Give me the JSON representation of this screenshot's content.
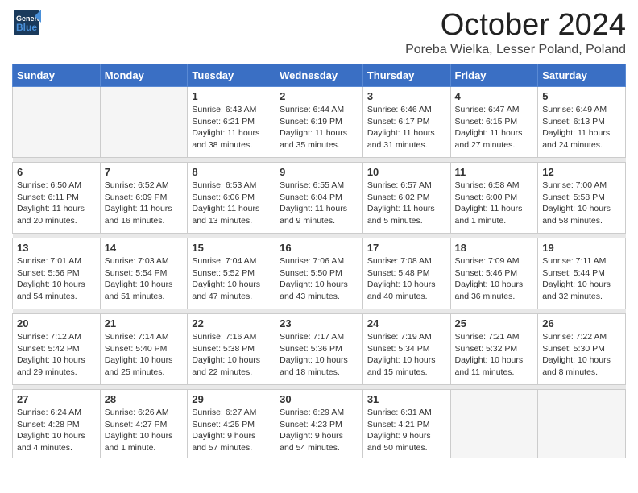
{
  "header": {
    "logo_line1": "General",
    "logo_line2": "Blue",
    "month": "October 2024",
    "location": "Poreba Wielka, Lesser Poland, Poland"
  },
  "days_of_week": [
    "Sunday",
    "Monday",
    "Tuesday",
    "Wednesday",
    "Thursday",
    "Friday",
    "Saturday"
  ],
  "weeks": [
    [
      {
        "date": "",
        "sunrise": "",
        "sunset": "",
        "daylight": "",
        "empty": true
      },
      {
        "date": "",
        "sunrise": "",
        "sunset": "",
        "daylight": "",
        "empty": true
      },
      {
        "date": "1",
        "sunrise": "Sunrise: 6:43 AM",
        "sunset": "Sunset: 6:21 PM",
        "daylight": "Daylight: 11 hours and 38 minutes.",
        "empty": false
      },
      {
        "date": "2",
        "sunrise": "Sunrise: 6:44 AM",
        "sunset": "Sunset: 6:19 PM",
        "daylight": "Daylight: 11 hours and 35 minutes.",
        "empty": false
      },
      {
        "date": "3",
        "sunrise": "Sunrise: 6:46 AM",
        "sunset": "Sunset: 6:17 PM",
        "daylight": "Daylight: 11 hours and 31 minutes.",
        "empty": false
      },
      {
        "date": "4",
        "sunrise": "Sunrise: 6:47 AM",
        "sunset": "Sunset: 6:15 PM",
        "daylight": "Daylight: 11 hours and 27 minutes.",
        "empty": false
      },
      {
        "date": "5",
        "sunrise": "Sunrise: 6:49 AM",
        "sunset": "Sunset: 6:13 PM",
        "daylight": "Daylight: 11 hours and 24 minutes.",
        "empty": false
      }
    ],
    [
      {
        "date": "6",
        "sunrise": "Sunrise: 6:50 AM",
        "sunset": "Sunset: 6:11 PM",
        "daylight": "Daylight: 11 hours and 20 minutes.",
        "empty": false
      },
      {
        "date": "7",
        "sunrise": "Sunrise: 6:52 AM",
        "sunset": "Sunset: 6:09 PM",
        "daylight": "Daylight: 11 hours and 16 minutes.",
        "empty": false
      },
      {
        "date": "8",
        "sunrise": "Sunrise: 6:53 AM",
        "sunset": "Sunset: 6:06 PM",
        "daylight": "Daylight: 11 hours and 13 minutes.",
        "empty": false
      },
      {
        "date": "9",
        "sunrise": "Sunrise: 6:55 AM",
        "sunset": "Sunset: 6:04 PM",
        "daylight": "Daylight: 11 hours and 9 minutes.",
        "empty": false
      },
      {
        "date": "10",
        "sunrise": "Sunrise: 6:57 AM",
        "sunset": "Sunset: 6:02 PM",
        "daylight": "Daylight: 11 hours and 5 minutes.",
        "empty": false
      },
      {
        "date": "11",
        "sunrise": "Sunrise: 6:58 AM",
        "sunset": "Sunset: 6:00 PM",
        "daylight": "Daylight: 11 hours and 1 minute.",
        "empty": false
      },
      {
        "date": "12",
        "sunrise": "Sunrise: 7:00 AM",
        "sunset": "Sunset: 5:58 PM",
        "daylight": "Daylight: 10 hours and 58 minutes.",
        "empty": false
      }
    ],
    [
      {
        "date": "13",
        "sunrise": "Sunrise: 7:01 AM",
        "sunset": "Sunset: 5:56 PM",
        "daylight": "Daylight: 10 hours and 54 minutes.",
        "empty": false
      },
      {
        "date": "14",
        "sunrise": "Sunrise: 7:03 AM",
        "sunset": "Sunset: 5:54 PM",
        "daylight": "Daylight: 10 hours and 51 minutes.",
        "empty": false
      },
      {
        "date": "15",
        "sunrise": "Sunrise: 7:04 AM",
        "sunset": "Sunset: 5:52 PM",
        "daylight": "Daylight: 10 hours and 47 minutes.",
        "empty": false
      },
      {
        "date": "16",
        "sunrise": "Sunrise: 7:06 AM",
        "sunset": "Sunset: 5:50 PM",
        "daylight": "Daylight: 10 hours and 43 minutes.",
        "empty": false
      },
      {
        "date": "17",
        "sunrise": "Sunrise: 7:08 AM",
        "sunset": "Sunset: 5:48 PM",
        "daylight": "Daylight: 10 hours and 40 minutes.",
        "empty": false
      },
      {
        "date": "18",
        "sunrise": "Sunrise: 7:09 AM",
        "sunset": "Sunset: 5:46 PM",
        "daylight": "Daylight: 10 hours and 36 minutes.",
        "empty": false
      },
      {
        "date": "19",
        "sunrise": "Sunrise: 7:11 AM",
        "sunset": "Sunset: 5:44 PM",
        "daylight": "Daylight: 10 hours and 32 minutes.",
        "empty": false
      }
    ],
    [
      {
        "date": "20",
        "sunrise": "Sunrise: 7:12 AM",
        "sunset": "Sunset: 5:42 PM",
        "daylight": "Daylight: 10 hours and 29 minutes.",
        "empty": false
      },
      {
        "date": "21",
        "sunrise": "Sunrise: 7:14 AM",
        "sunset": "Sunset: 5:40 PM",
        "daylight": "Daylight: 10 hours and 25 minutes.",
        "empty": false
      },
      {
        "date": "22",
        "sunrise": "Sunrise: 7:16 AM",
        "sunset": "Sunset: 5:38 PM",
        "daylight": "Daylight: 10 hours and 22 minutes.",
        "empty": false
      },
      {
        "date": "23",
        "sunrise": "Sunrise: 7:17 AM",
        "sunset": "Sunset: 5:36 PM",
        "daylight": "Daylight: 10 hours and 18 minutes.",
        "empty": false
      },
      {
        "date": "24",
        "sunrise": "Sunrise: 7:19 AM",
        "sunset": "Sunset: 5:34 PM",
        "daylight": "Daylight: 10 hours and 15 minutes.",
        "empty": false
      },
      {
        "date": "25",
        "sunrise": "Sunrise: 7:21 AM",
        "sunset": "Sunset: 5:32 PM",
        "daylight": "Daylight: 10 hours and 11 minutes.",
        "empty": false
      },
      {
        "date": "26",
        "sunrise": "Sunrise: 7:22 AM",
        "sunset": "Sunset: 5:30 PM",
        "daylight": "Daylight: 10 hours and 8 minutes.",
        "empty": false
      }
    ],
    [
      {
        "date": "27",
        "sunrise": "Sunrise: 6:24 AM",
        "sunset": "Sunset: 4:28 PM",
        "daylight": "Daylight: 10 hours and 4 minutes.",
        "empty": false
      },
      {
        "date": "28",
        "sunrise": "Sunrise: 6:26 AM",
        "sunset": "Sunset: 4:27 PM",
        "daylight": "Daylight: 10 hours and 1 minute.",
        "empty": false
      },
      {
        "date": "29",
        "sunrise": "Sunrise: 6:27 AM",
        "sunset": "Sunset: 4:25 PM",
        "daylight": "Daylight: 9 hours and 57 minutes.",
        "empty": false
      },
      {
        "date": "30",
        "sunrise": "Sunrise: 6:29 AM",
        "sunset": "Sunset: 4:23 PM",
        "daylight": "Daylight: 9 hours and 54 minutes.",
        "empty": false
      },
      {
        "date": "31",
        "sunrise": "Sunrise: 6:31 AM",
        "sunset": "Sunset: 4:21 PM",
        "daylight": "Daylight: 9 hours and 50 minutes.",
        "empty": false
      },
      {
        "date": "",
        "sunrise": "",
        "sunset": "",
        "daylight": "",
        "empty": true
      },
      {
        "date": "",
        "sunrise": "",
        "sunset": "",
        "daylight": "",
        "empty": true
      }
    ]
  ]
}
